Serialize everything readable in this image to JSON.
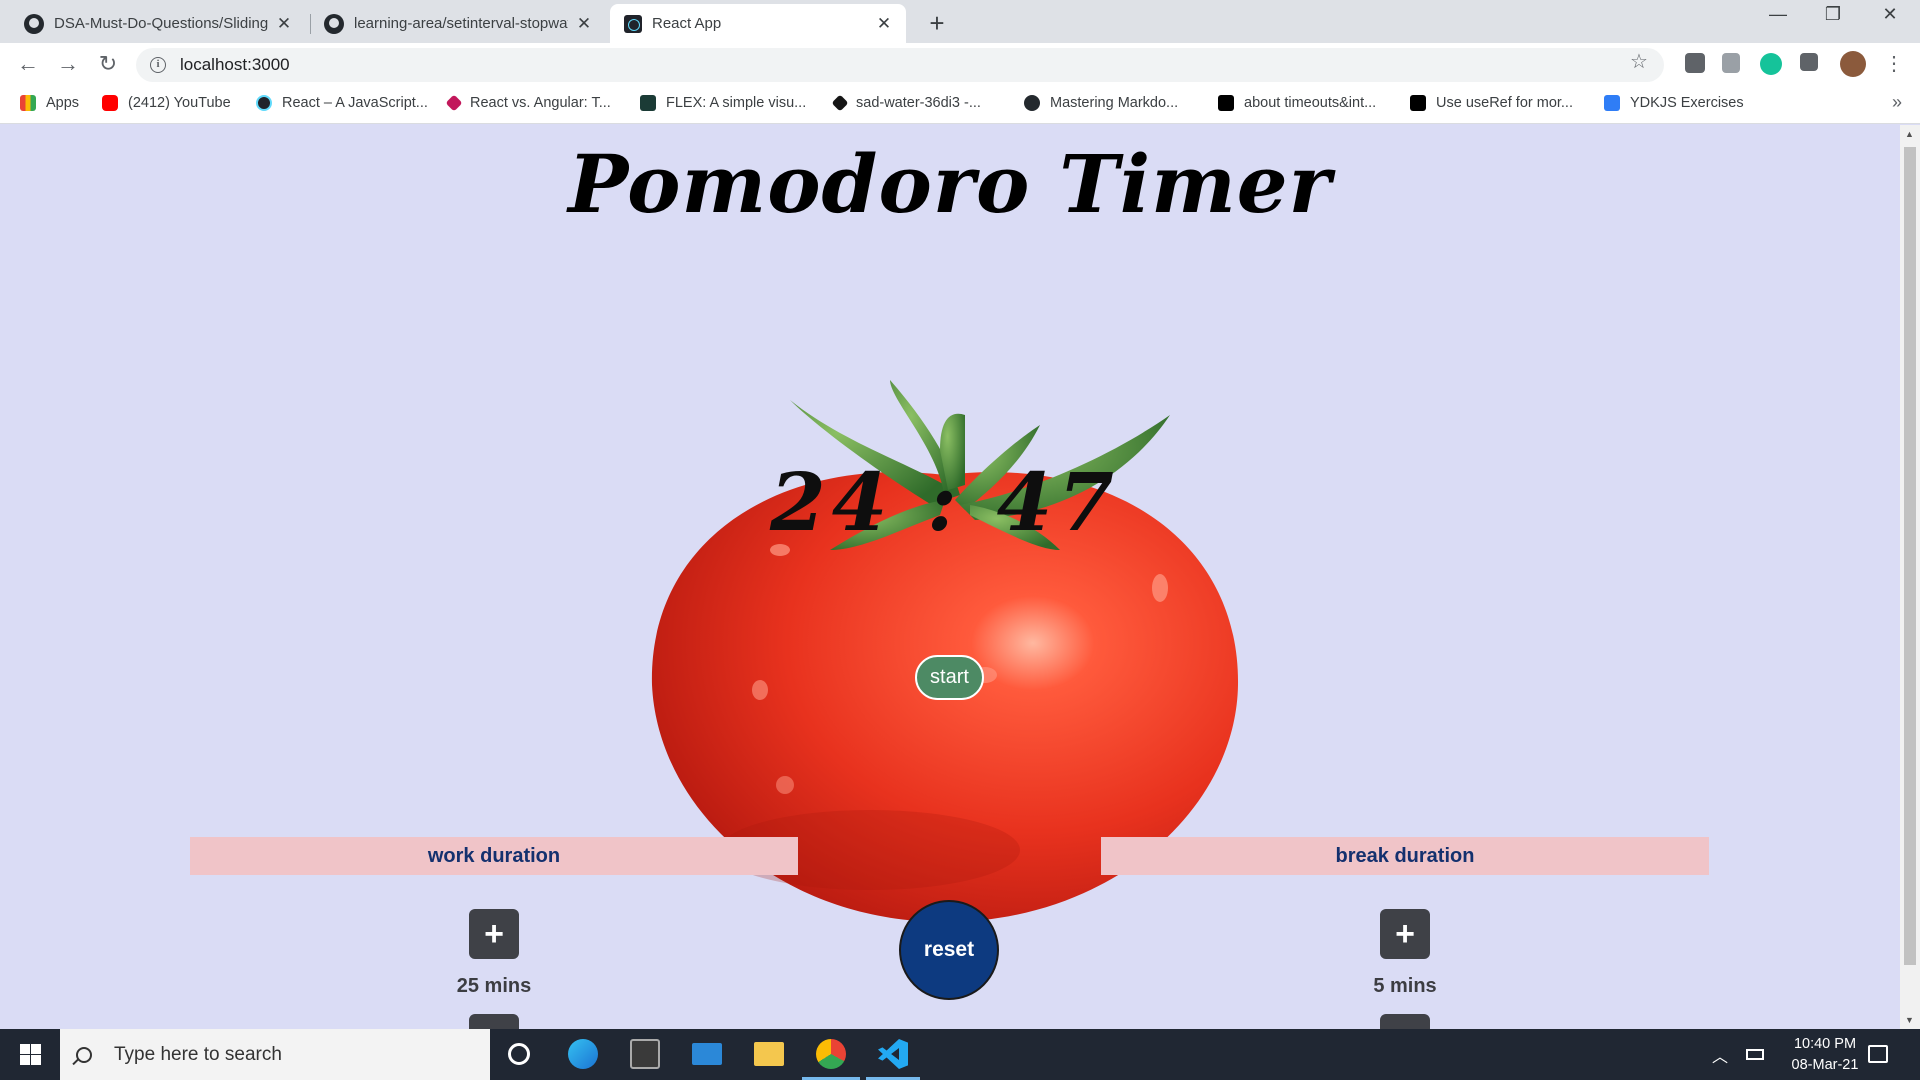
{
  "browser": {
    "tabs": [
      {
        "title": "DSA-Must-Do-Questions/Sliding",
        "icon": "github-icon"
      },
      {
        "title": "learning-area/setinterval-stopwat",
        "icon": "github-icon"
      },
      {
        "title": "React App",
        "icon": "react-icon",
        "active": true
      }
    ],
    "url": "localhost:3000",
    "bookmarks": [
      {
        "label": "Apps",
        "icon": "apps-grid-icon"
      },
      {
        "label": "(2412) YouTube",
        "icon": "youtube-icon"
      },
      {
        "label": "React – A JavaScript...",
        "icon": "react-icon"
      },
      {
        "label": "React vs. Angular: T...",
        "icon": "gem-icon"
      },
      {
        "label": "FLEX: A simple visu...",
        "icon": "flex-icon"
      },
      {
        "label": "sad-water-36di3 -...",
        "icon": "codesandbox-icon"
      },
      {
        "label": "Mastering Markdo...",
        "icon": "github-icon"
      },
      {
        "label": "about timeouts&int...",
        "icon": "book-icon"
      },
      {
        "label": "Use useRef for mor...",
        "icon": "video-icon"
      },
      {
        "label": "YDKJS Exercises",
        "icon": "js-icon"
      }
    ]
  },
  "app": {
    "title": "Pomodoro Timer",
    "timer": "24 : 47",
    "start_label": "start",
    "reset_label": "reset",
    "work": {
      "heading": "work duration",
      "plus": "+",
      "value": "25 mins"
    },
    "break": {
      "heading": "break duration",
      "plus": "+",
      "value": "5 mins"
    }
  },
  "taskbar": {
    "search_placeholder": "Type here to search",
    "time": "10:40 PM",
    "date": "08-Mar-21"
  },
  "colors": {
    "page_bg": "#dadcf5",
    "tomato": "#e8321e",
    "start_btn": "#4d8a64",
    "reset_btn": "#0d3a80",
    "duration_heading_bg": "#f0c4c8",
    "duration_heading_text": "#14306e"
  }
}
